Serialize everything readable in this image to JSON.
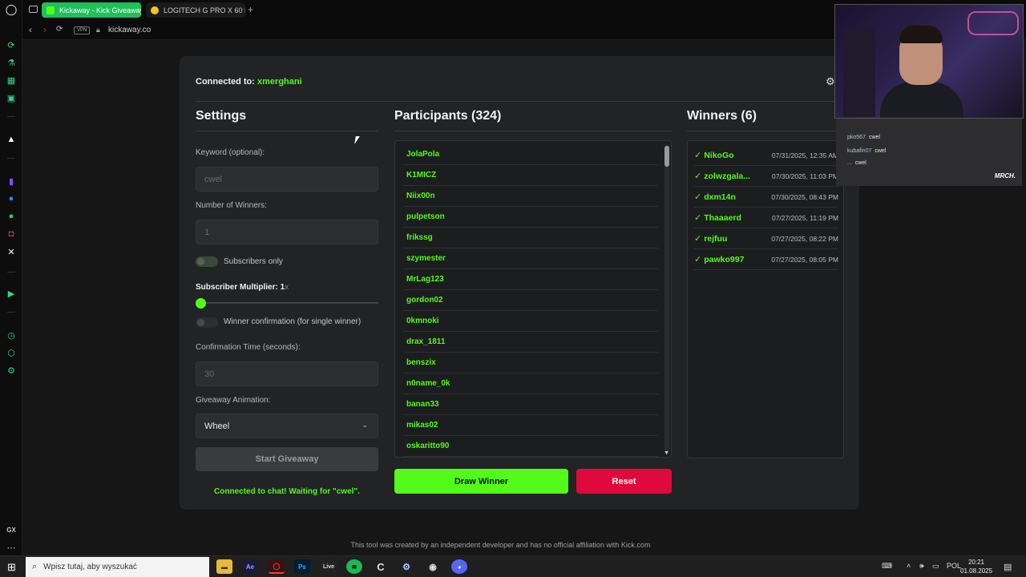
{
  "browser": {
    "tabs": [
      {
        "label": "Kickaway - Kick Giveaway",
        "favicon_color": "#53fc18"
      },
      {
        "label": "LOGITECH G PRO X 60 LI",
        "favicon_color": "#f5c518"
      }
    ],
    "new_tab": "+",
    "vpn": "VPN",
    "url": "kickaway.co"
  },
  "page": {
    "connected_prefix": "Connected to:",
    "connected_user": "xmerghani",
    "settings": {
      "title": "Settings",
      "keyword_label": "Keyword (optional):",
      "keyword_value": "cwel",
      "winners_label": "Number of Winners:",
      "winners_value": "1",
      "subscribers_only_label": "Subscribers only",
      "multiplier_label": "Subscriber Multiplier: 1",
      "multiplier_suffix": "x",
      "multiplier_value": 1,
      "confirmation_label": "Winner confirmation (for single winner)",
      "confirm_time_label": "Confirmation Time (seconds):",
      "confirm_time_value": "30",
      "animation_label": "Giveaway Animation:",
      "animation_value": "Wheel",
      "start_button": "Start Giveaway",
      "status": "Connected to chat! Waiting for \"cwel\"."
    },
    "participants": {
      "title": "Participants (324)",
      "names": [
        "JolaPola",
        "K1MICZ",
        "Niix00n",
        "pulpetson",
        "frikssg",
        "szymester",
        "MrLag123",
        "gordon02",
        "0kmnoki",
        "drax_1811",
        "benszix",
        "n0name_0k",
        "banan33",
        "mikas02",
        "oskaritto90"
      ],
      "draw_button": "Draw Winner",
      "reset_button": "Reset"
    },
    "winners": {
      "title": "Winners (6)",
      "check": "✓",
      "items": [
        {
          "name": "NikoGo",
          "date": "07/31/2025, 12:35 AM"
        },
        {
          "name": "zolwzgala...",
          "date": "07/30/2025, 11:03 PM"
        },
        {
          "name": "dxm14n",
          "date": "07/30/2025, 08:43 PM"
        },
        {
          "name": "Thaaaerd",
          "date": "07/27/2025, 11:19 PM"
        },
        {
          "name": "rejfuu",
          "date": "07/27/2025, 08:22 PM"
        },
        {
          "name": "pawko997",
          "date": "07/27/2025, 08:05 PM"
        }
      ]
    },
    "footer": "This tool was created by an independent developer and has no official affiliation with Kick.com"
  },
  "overlay": {
    "chat": [
      {
        "user": "pko567",
        "msg": "cwel"
      },
      {
        "user": "kubafin07",
        "msg": "cwel"
      },
      {
        "user": "...",
        "msg": "cwel"
      }
    ],
    "badge": "MRCH."
  },
  "taskbar": {
    "search_placeholder": "Wpisz tutaj, aby wyszukać",
    "language": "POL",
    "time": "20:21",
    "date": "01.08.2025",
    "apps": [
      "Ae",
      "Ps",
      "Live"
    ]
  },
  "colors": {
    "accent": "#53fc18",
    "danger": "#e0093b",
    "card": "#222325"
  }
}
